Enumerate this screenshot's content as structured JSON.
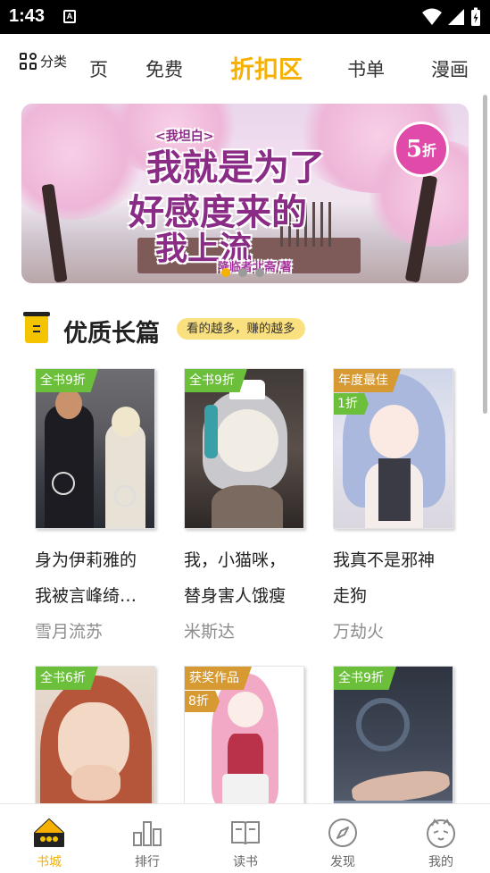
{
  "status_bar": {
    "time": "1:43",
    "notif_letter": "A"
  },
  "top_nav": {
    "category_label": "分类",
    "tabs": [
      {
        "label": "页",
        "active": false
      },
      {
        "label": "免费",
        "active": false
      },
      {
        "label": "折扣区",
        "active": true
      },
      {
        "label": "书单",
        "active": false
      },
      {
        "label": "漫画",
        "active": false
      }
    ]
  },
  "banner": {
    "title_small": "<我坦白>",
    "title_line1": "我就是为了",
    "title_line2": "好感度来的",
    "title_line3": "我上流",
    "author_line": "降临者北斋/著",
    "discount_num": "5",
    "discount_unit": "折",
    "dots": 3,
    "active_dot": 0
  },
  "section": {
    "title": "优质长篇",
    "tag": "看的越多，赚的越多"
  },
  "books": [
    {
      "tag": "全书9折",
      "tag_color": "#6bbf3a",
      "title1": "身为伊莉雅的",
      "title2": "我被言峰绮…",
      "author": "雪月流苏"
    },
    {
      "tag": "全书9折",
      "tag_color": "#6bbf3a",
      "title1": "我，小猫咪，",
      "title2": "替身害人饿瘦",
      "author": "米斯达"
    },
    {
      "tag": "年度最佳",
      "tag_color": "#d79a32",
      "discount": "1折",
      "title1": "我真不是邪神",
      "title2": "走狗",
      "author": "万劫火"
    },
    {
      "tag": "全书6折",
      "tag_color": "#6bbf3a",
      "title1": "",
      "title2": "",
      "author": ""
    },
    {
      "tag": "获奖作品",
      "tag_color": "#d79a32",
      "discount": "8折",
      "title1": "",
      "title2": "",
      "author": ""
    },
    {
      "tag": "全书9折",
      "tag_color": "#6bbf3a",
      "title1": "",
      "title2": "",
      "author": ""
    }
  ],
  "bottom_nav": [
    {
      "label": "书城",
      "icon": "house-icon",
      "active": true
    },
    {
      "label": "排行",
      "icon": "bar-chart-icon",
      "active": false
    },
    {
      "label": "读书",
      "icon": "book-icon",
      "active": false
    },
    {
      "label": "发现",
      "icon": "compass-icon",
      "active": false
    },
    {
      "label": "我的",
      "icon": "cat-face-icon",
      "active": false
    }
  ],
  "colors": {
    "accent": "#f5b000",
    "green_tag": "#6bbf3a",
    "gold_tag": "#d79a32"
  }
}
